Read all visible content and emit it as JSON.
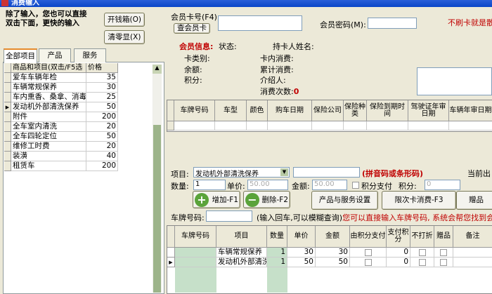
{
  "window": {
    "title": "消费输入"
  },
  "left": {
    "hint": "除了输入，您也可以直接\n双击下面，更快的输入",
    "hint1": "除了输入，您也可以直接",
    "hint2": "双击下面，更快的输入",
    "open_drawer": "开钱箱(O)",
    "clear_display": "清零显(X)",
    "tabs": [
      "全部项目",
      "产品",
      "服务"
    ],
    "columns": [
      "商品和项目(双击/F5选",
      "价格"
    ],
    "items": [
      [
        "爱车车辆年检",
        "35"
      ],
      [
        "车辆常规保养",
        "30"
      ],
      [
        "车内熏香、桑拿、消毒",
        "25"
      ],
      [
        "发动机外部清洗保养",
        "50"
      ],
      [
        "附件",
        "200"
      ],
      [
        "全车室内清洗",
        "20"
      ],
      [
        "全车四轮定位",
        "50"
      ],
      [
        "维修工时费",
        "20"
      ],
      [
        "装潢",
        "40"
      ],
      [
        "租赁车",
        "200"
      ]
    ],
    "selected_index": 3
  },
  "member": {
    "card_label": "会员卡号(F4):",
    "lookup_button": "查会员卡",
    "password_label": "会员密码(M):",
    "no_card_note": "不刷卡就是散",
    "info_label": "会员信息:",
    "status": "状态:",
    "holder": "持卡人姓名:",
    "card_type": "卡类别:",
    "balance": "余额:",
    "points": "积分:",
    "in_card": "卡内消费:",
    "total": "累计消费:",
    "referrer": "介绍人:",
    "count_label": "消费次数:",
    "count": "0"
  },
  "vehicle_grid": {
    "columns": [
      "车牌号码",
      "车型",
      "颜色",
      "购车日期",
      "保险公司",
      "保险种类",
      "保险到期时间",
      "驾驶证年审日期",
      "车辆年审日期"
    ]
  },
  "entry": {
    "item_label": "项目:",
    "item_value": "发动机外部清洗保养",
    "code_hint": "(拼音码或条形码)",
    "current": "当前出",
    "qty_label": "数量:",
    "qty": "1",
    "price_label": "单价:",
    "price": "50.00",
    "amount_label": "金额:",
    "amount": "50.00",
    "points_pay": "积分支付",
    "points_label": "积分:",
    "points": "0",
    "add": "增加-F1",
    "delete": "删除-F2",
    "settings": "产品与服务设置",
    "limited": "限次卡消费-F3",
    "gift": "赠品",
    "plate_label": "车牌号码:",
    "plate_hint": "(输入回车,可以模糊查询)",
    "plate_note": "您可以直接输入车牌号码, 系统会帮您找到会员"
  },
  "order_grid": {
    "columns": [
      "车牌号码",
      "项目",
      "数量",
      "单价",
      "金额",
      "由积分支付",
      "支付积分",
      "不打折",
      "赠品",
      "备注"
    ],
    "rows": [
      [
        "",
        "车辆常规保养",
        "1",
        "30",
        "30",
        "",
        "0",
        "",
        "",
        ""
      ],
      [
        "",
        "发动机外部清洗",
        "1",
        "50",
        "50",
        "",
        "0",
        "",
        "",
        ""
      ]
    ]
  }
}
